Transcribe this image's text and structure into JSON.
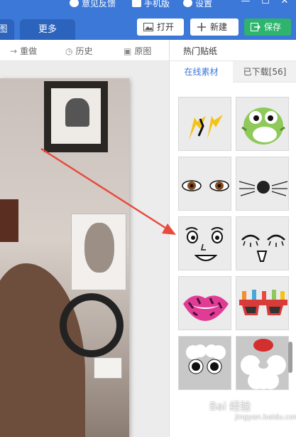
{
  "titlebar": {
    "feedback": "意见反馈",
    "mobile": "手机版",
    "settings": "设置",
    "minimize": "—",
    "maximize": "☐",
    "close": "✕"
  },
  "tabs": [
    {
      "label": "图"
    },
    {
      "label": "更多"
    }
  ],
  "buttons": {
    "open": "打开",
    "new": "新建",
    "save": "保存"
  },
  "toolbar": {
    "redo": "重做",
    "history": "历史",
    "original": "原图"
  },
  "panel": {
    "title": "热门贴纸",
    "tab_online": "在线素材",
    "tab_downloaded": "已下载[56]"
  },
  "stickers": [
    {
      "name": "lightning"
    },
    {
      "name": "green-monster"
    },
    {
      "name": "brown-eyes"
    },
    {
      "name": "whiskers-nose"
    },
    {
      "name": "cartoon-face"
    },
    {
      "name": "closed-eyes-smile"
    },
    {
      "name": "pink-leopard-lips"
    },
    {
      "name": "birthday-glasses"
    },
    {
      "name": "cloud-eyes"
    },
    {
      "name": "santa-beard"
    }
  ],
  "watermark": {
    "main": "Bai 经验",
    "sub": "jingyan.baidu.com"
  },
  "colors": {
    "header": "#3b78d8",
    "save": "#2fb46e",
    "arrow": "#e84a3c"
  }
}
